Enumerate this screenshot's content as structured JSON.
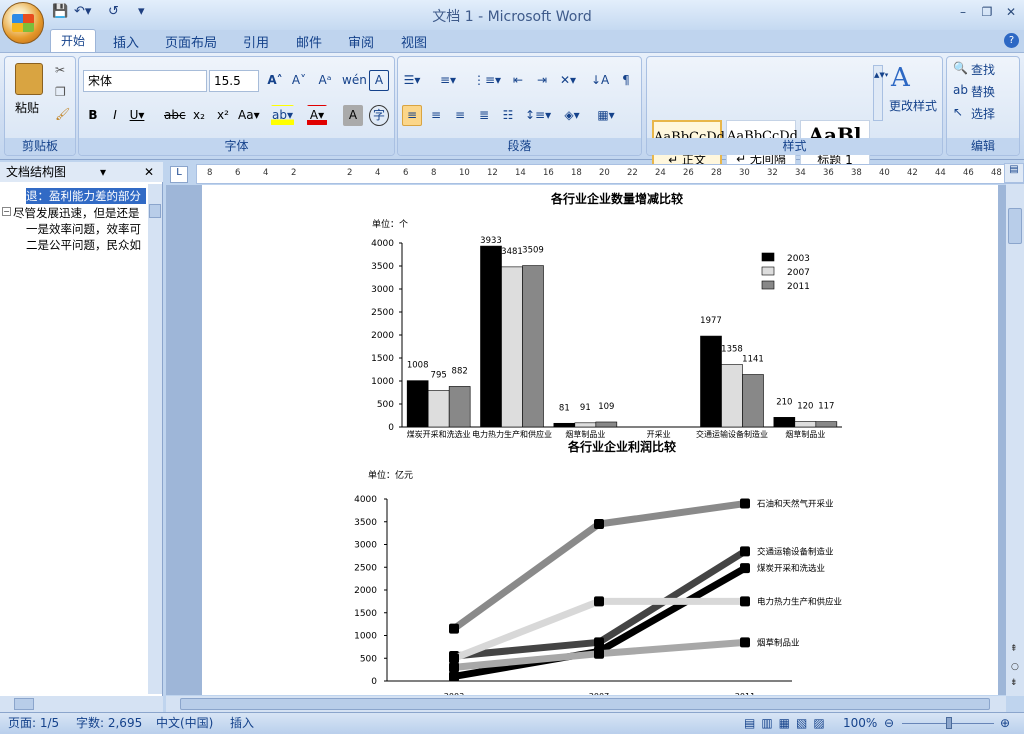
{
  "window": {
    "title": "文档 1 - Microsoft Word"
  },
  "tabs": [
    "开始",
    "插入",
    "页面布局",
    "引用",
    "邮件",
    "审阅",
    "视图"
  ],
  "clipboard": {
    "paste": "粘贴",
    "label": "剪贴板"
  },
  "font": {
    "name": "宋体",
    "size": "15.5",
    "label": "字体"
  },
  "paragraph": {
    "label": "段落"
  },
  "styles": {
    "label": "样式",
    "change": "更改样式",
    "items": [
      {
        "preview": "AaBbCcDd",
        "name": "↵ 正文"
      },
      {
        "preview": "AaBbCcDd",
        "name": "↵ 无间隔"
      },
      {
        "preview": "AaBl",
        "name": "标题 1"
      }
    ]
  },
  "editing": {
    "label": "编辑",
    "find": "查找",
    "replace": "替换",
    "select": "选择"
  },
  "nav": {
    "title": "文档结构图",
    "items": [
      "退：盈利能力差的部分",
      "尽管发展迅速，但是还是",
      "一是效率问题，效率可",
      "二是公平问题，民众如"
    ]
  },
  "ruler": {
    "ticks": [
      "8",
      "6",
      "4",
      "2",
      "",
      "2",
      "4",
      "6",
      "8",
      "10",
      "12",
      "14",
      "16",
      "18",
      "20",
      "22",
      "24",
      "26",
      "28",
      "30",
      "32",
      "34",
      "36",
      "38",
      "40",
      "42",
      "44",
      "46",
      "48"
    ]
  },
  "status": {
    "page": "页面: 1/5",
    "words": "字数: 2,695",
    "lang": "中文(中国)",
    "mode": "插入",
    "zoom": "100%"
  },
  "chart_data": [
    {
      "type": "bar",
      "title": "各行业企业数量增减比较",
      "ylabel": "单位：个",
      "ylim": [
        0,
        4000
      ],
      "yticks": [
        0,
        500,
        1000,
        1500,
        2000,
        2500,
        3000,
        3500,
        4000
      ],
      "categories": [
        "煤炭开采和洗选业",
        "电力热力生产和供应业",
        "烟草制品业",
        "开采业",
        "交通运输设备制造业",
        "烟草制品业"
      ],
      "series": [
        {
          "name": "2003",
          "color": "#000000",
          "values": [
            1008,
            3933,
            81,
            null,
            1977,
            210
          ]
        },
        {
          "name": "2007",
          "color": "#dddddd",
          "values": [
            795,
            3481,
            91,
            null,
            1358,
            120
          ]
        },
        {
          "name": "2011",
          "color": "#888888",
          "values": [
            882,
            3509,
            109,
            null,
            1141,
            117
          ]
        }
      ],
      "legend": "top-right"
    },
    {
      "type": "line",
      "title": "各行业企业利润比较",
      "ylabel": "单位：亿元",
      "ylim": [
        0,
        4000
      ],
      "yticks": [
        0,
        500,
        1000,
        1500,
        2000,
        2500,
        3000,
        3500,
        4000
      ],
      "x": [
        "2003",
        "2007",
        "2011"
      ],
      "series": [
        {
          "name": "石油和天然气开采业",
          "color": "#8a8a8a",
          "values": [
            1150,
            3450,
            3900
          ]
        },
        {
          "name": "交通运输设备制造业",
          "color": "#444444",
          "values": [
            550,
            850,
            2850
          ]
        },
        {
          "name": "煤炭开采和洗选业",
          "color": "#000000",
          "values": [
            100,
            650,
            2480
          ]
        },
        {
          "name": "电力热力生产和供应业",
          "color": "#d8d8d8",
          "values": [
            500,
            1750,
            1750
          ]
        },
        {
          "name": "烟草制品业",
          "color": "#a8a8a8",
          "values": [
            300,
            600,
            850
          ]
        }
      ]
    }
  ]
}
